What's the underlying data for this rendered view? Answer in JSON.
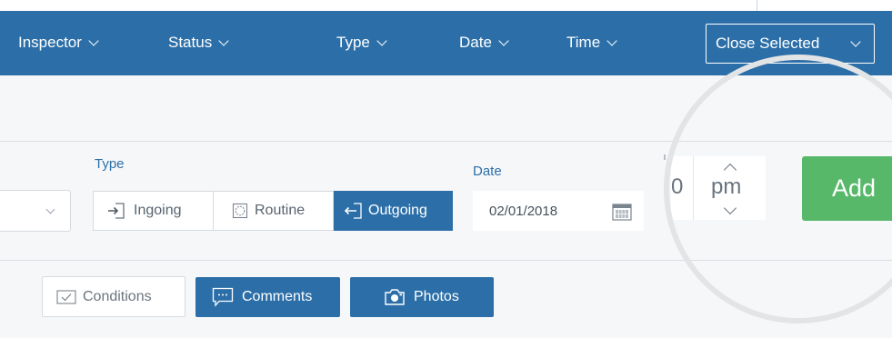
{
  "header": {
    "columns": [
      {
        "label": "Inspector"
      },
      {
        "label": "Status"
      },
      {
        "label": "Type"
      },
      {
        "label": "Date"
      },
      {
        "label": "Time"
      }
    ],
    "close_selected_label": "Close Selected"
  },
  "form": {
    "type_label": "Type",
    "type_options": [
      {
        "label": "Ingoing",
        "icon": "arrow-in-icon",
        "selected": false
      },
      {
        "label": "Routine",
        "icon": "circle-icon",
        "selected": false
      },
      {
        "label": "Outgoing",
        "icon": "arrow-out-icon",
        "selected": true
      }
    ],
    "date_label": "Date",
    "date_value": "02/01/2018",
    "time_fragment": "0",
    "ampm": "pm",
    "add_label": "Add"
  },
  "actions": {
    "conditions_label": "Conditions",
    "comments_label": "Comments",
    "photos_label": "Photos"
  },
  "colors": {
    "header_blue": "#2c6fa8",
    "add_green": "#58b86a",
    "background": "#f6f7f9"
  }
}
